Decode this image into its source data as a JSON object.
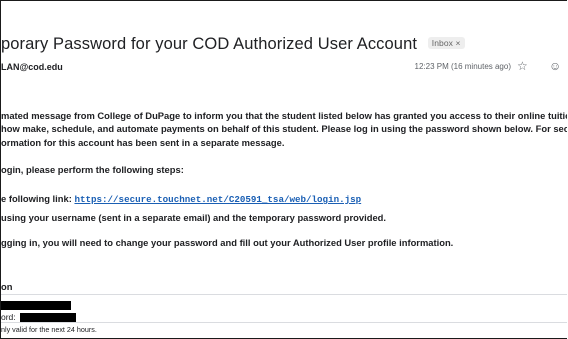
{
  "email": {
    "subject": "porary Password for your COD Authorized User Account",
    "label": "Inbox ×",
    "sender": "LAN@cod.edu",
    "time": "12:23 PM (16 minutes ago)"
  },
  "body": {
    "line1": "mated message from College of DuPage to inform you that the student listed below has granted you access to their online tuition p",
    "line2": "how make, schedule, and automate payments on behalf of this student. Please log in using the password shown below. For security",
    "line3": "ormation for this account has been sent in a separate message.",
    "steps_intro": "ogin, please perform the following steps:",
    "link_intro": "e following link:",
    "link_url": "https://secure.touchnet.net/C20591_tsa/web/login.jsp",
    "login_step": "using your username (sent in a separate email) and the temporary password provided.",
    "after_login": "gging in, you will need to change your password and fill out your Authorized User profile information.",
    "signature": "on",
    "password_label": "ord:",
    "validity": "nly valid for the next 24 hours."
  }
}
